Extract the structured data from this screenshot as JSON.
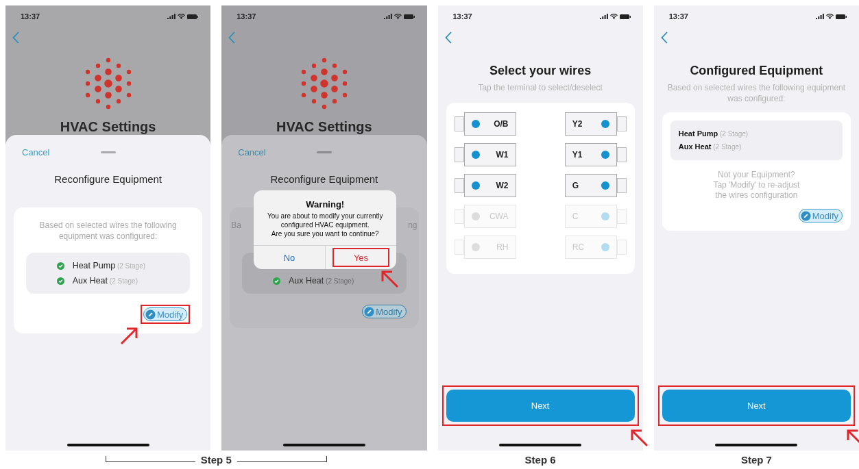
{
  "screens": [
    {
      "kind": "sheet",
      "dimmed": false,
      "status": {
        "time": "13:37"
      },
      "background_title": "HVAC Settings",
      "sheet": {
        "cancel": "Cancel",
        "title": "Reconfigure Equipment",
        "description": "Based on selected wires the following equipment was configured:",
        "equipment": [
          {
            "label": "**Heat Pump** (2 Stage)",
            "checked": true
          },
          {
            "label": "**Aux Heat** (2 Stage)",
            "checked": true
          }
        ],
        "modify": {
          "label": "Modify",
          "highlighted": true,
          "arrow": {
            "kind": "up-right"
          }
        }
      }
    },
    {
      "kind": "sheet",
      "dimmed": true,
      "status": {
        "time": "13:37"
      },
      "background_title": "HVAC Settings",
      "sheet": {
        "cancel": "Cancel",
        "title": "Reconfigure Equipment",
        "description_fragments": [
          "Ba",
          "ng"
        ],
        "equipment": [
          {
            "label": "**Aux Heat** (2 Stage)",
            "checked": true
          }
        ],
        "modify": {
          "label": "Modify",
          "highlighted": false
        }
      },
      "alert": {
        "title": "Warning!",
        "message": "You are about to modify your currently configured HVAC equipment.\nAre you sure you want to continue?",
        "buttons": [
          {
            "label": "No",
            "kind": "cancel",
            "highlighted": false
          },
          {
            "label": "Yes",
            "kind": "destructive",
            "highlighted": true,
            "arrow": {
              "kind": "up-left"
            }
          }
        ]
      }
    },
    {
      "kind": "wires",
      "status": {
        "time": "13:37"
      },
      "title": "Select your wires",
      "subtitle": "Tap the terminal to select/deselect",
      "terminals": [
        {
          "label": "O/B",
          "selected": true,
          "color": "#1591d0"
        },
        {
          "label": "Y2",
          "selected": true,
          "color": "#1591d0"
        },
        {
          "label": "W1",
          "selected": true,
          "color": "#1591d0"
        },
        {
          "label": "Y1",
          "selected": true,
          "color": "#1591d0"
        },
        {
          "label": "W2",
          "selected": true,
          "color": "#1591d0"
        },
        {
          "label": "G",
          "selected": true,
          "color": "#1591d0"
        },
        {
          "label": "CWA",
          "selected": false,
          "color": "#dddddd"
        },
        {
          "label": "C",
          "selected": false,
          "color": "#b3dcf0"
        },
        {
          "label": "RH",
          "selected": false,
          "color": "#dddddd"
        },
        {
          "label": "RC",
          "selected": false,
          "color": "#b3dcf0"
        }
      ],
      "next": {
        "label": "Next",
        "highlighted": true,
        "arrow": {
          "kind": "up-left"
        }
      }
    },
    {
      "kind": "summary",
      "status": {
        "time": "13:37"
      },
      "title": "Configured Equipment",
      "subtitle": "Based on selected wires the following equipment was configured:",
      "equipment": [
        {
          "label": "**Heat Pump** (2 Stage)"
        },
        {
          "label": "**Aux Heat** (2 Stage)"
        }
      ],
      "note": "Not your Equipment?\nTap 'Modify' to re-adjust\nthe wires configuration",
      "modify": {
        "label": "Modify",
        "highlighted": false
      },
      "next": {
        "label": "Next",
        "highlighted": true,
        "arrow": {
          "kind": "up-left"
        }
      }
    }
  ],
  "captions": [
    {
      "label": "Step 5",
      "kind": "bracket"
    },
    {
      "label": "Step 6",
      "kind": "plain"
    },
    {
      "label": "Step 7",
      "kind": "plain"
    }
  ]
}
